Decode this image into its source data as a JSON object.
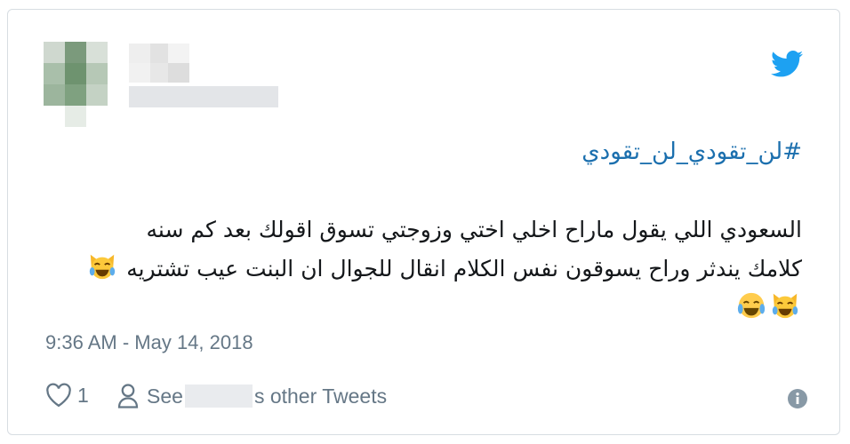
{
  "tweet": {
    "hashtag": "#لن_تقودي_لن_تقودي",
    "text_line1": "السعودي اللي يقول ماراح اخلي اختي وزوجتي تسوق اقولك بعد كم سنه",
    "text_line2": "كلامك يندثر وراح يسوقون نفس الكلام انقال للجوال ان البنت عيب تشتريه",
    "timestamp": "9:36 AM - May 14, 2018"
  },
  "footer": {
    "like_count": "1",
    "see_prefix": "See",
    "see_suffix": "s other Tweets"
  },
  "icons": {
    "bird": "twitter-bird-icon",
    "heart": "heart-icon",
    "person": "person-icon",
    "info": "info-icon",
    "emoji": "face-with-tears-of-joy-cat-icon"
  },
  "colors": {
    "twitter_blue": "#1da1f2",
    "link_blue": "#1b6fae",
    "muted_gray": "#657786",
    "text": "#14171a"
  }
}
